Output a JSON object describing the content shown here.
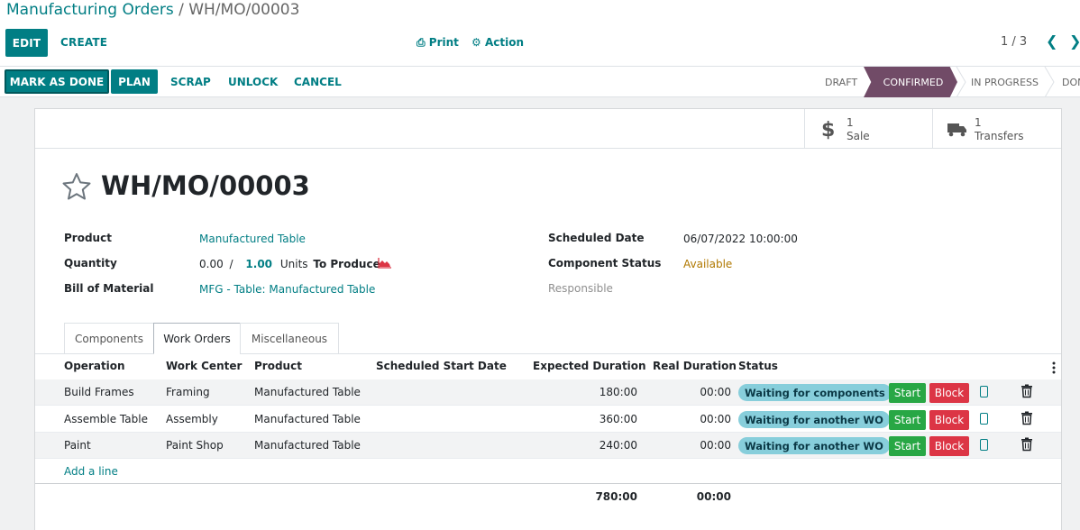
{
  "breadcrumb": {
    "parent": "Manufacturing Orders",
    "separator": " / ",
    "current": "WH/MO/00003"
  },
  "toolbar": {
    "edit": "EDIT",
    "create": "CREATE",
    "print": "Print",
    "action": "Action"
  },
  "pager": {
    "value": "1 / 3"
  },
  "header_buttons": {
    "mark_done": "MARK AS DONE",
    "plan": "PLAN",
    "scrap": "SCRAP",
    "unlock": "UNLOCK",
    "cancel": "CANCEL"
  },
  "statusbar": {
    "draft": "DRAFT",
    "confirmed": "CONFIRMED",
    "in_progress": "IN PROGRESS",
    "done": "DONE",
    "active": "CONFIRMED"
  },
  "smart_buttons": [
    {
      "value": "1",
      "label": "Sale",
      "icon": "dollar-icon"
    },
    {
      "value": "1",
      "label": "Transfers",
      "icon": "truck-icon"
    }
  ],
  "record": {
    "title": "WH/MO/00003",
    "product_label": "Product",
    "product": "Manufactured Table",
    "quantity_label": "Quantity",
    "qty_produced": "0.00",
    "qty_sep": "/",
    "qty_total": "1.00",
    "uom": "Units",
    "to_produce": "To Produce",
    "bom_label": "Bill of Material",
    "bom": "MFG - Table: Manufactured Table",
    "scheduled_label": "Scheduled Date",
    "scheduled": "06/07/2022 10:00:00",
    "component_status_label": "Component Status",
    "component_status": "Available",
    "responsible_label": "Responsible"
  },
  "tabs": [
    "Components",
    "Work Orders",
    "Miscellaneous"
  ],
  "active_tab": "Work Orders",
  "table": {
    "columns": [
      "Operation",
      "Work Center",
      "Product",
      "Scheduled Start Date",
      "Expected Duration",
      "Real Duration",
      "Status"
    ],
    "rows": [
      {
        "operation": "Build Frames",
        "work_center": "Framing",
        "product": "Manufactured Table",
        "start": "",
        "expected": "180:00",
        "real": "00:00",
        "status": "Waiting for components"
      },
      {
        "operation": "Assemble Table",
        "work_center": "Assembly",
        "product": "Manufactured Table",
        "start": "",
        "expected": "360:00",
        "real": "00:00",
        "status": "Waiting for another WO"
      },
      {
        "operation": "Paint",
        "work_center": "Paint Shop",
        "product": "Manufactured Table",
        "start": "",
        "expected": "240:00",
        "real": "00:00",
        "status": "Waiting for another WO"
      }
    ],
    "start_label": "Start",
    "block_label": "Block",
    "add_line": "Add a line",
    "total_expected": "780:00",
    "total_real": "00:00"
  },
  "colors": {
    "primary": "#017e84",
    "stage_active": "#714b67",
    "start": "#28a745",
    "block": "#dc3545",
    "badge": "#87cedb",
    "available": "#b07800"
  }
}
